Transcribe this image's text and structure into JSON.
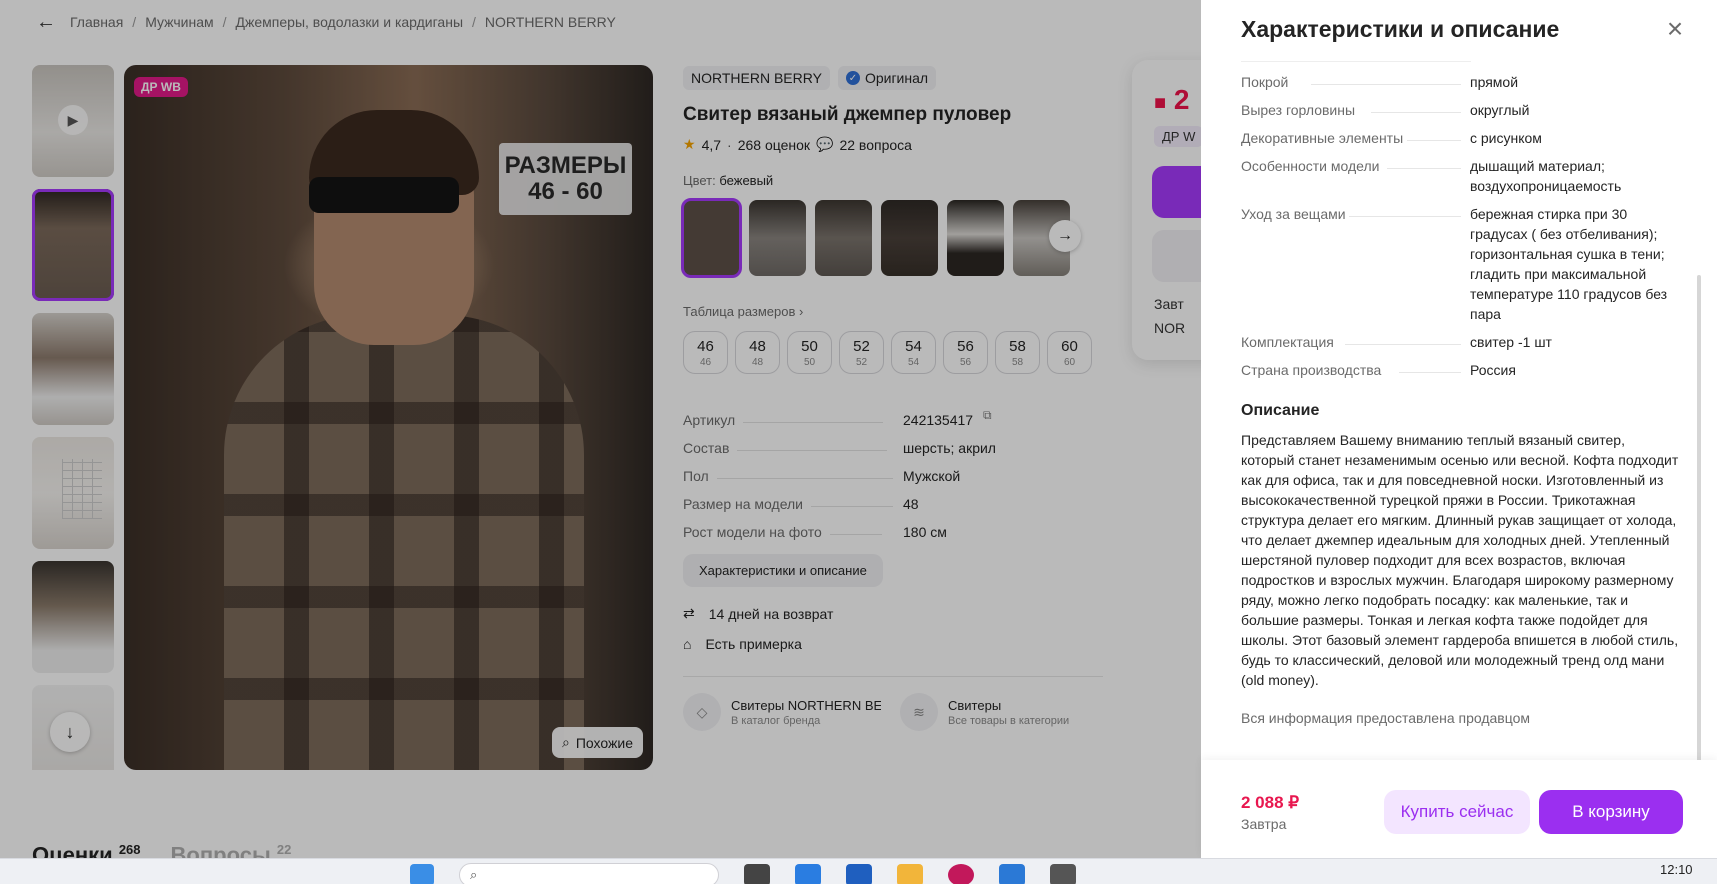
{
  "breadcrumbs": [
    "Главная",
    "Мужчинам",
    "Джемперы, водолазки и кардиганы",
    "NORTHERN BERRY"
  ],
  "gallery": {
    "badge": "ДР WB",
    "size_banner_line1": "РАЗМЕРЫ",
    "size_banner_line2": "46 - 60",
    "similar_label": "Похожие"
  },
  "product": {
    "brand": "NORTHERN BERRY",
    "original_label": "Оригинал",
    "title": "Свитер вязаный джемпер пуловер",
    "rating": "4,7",
    "reviews": "268 оценок",
    "questions": "22 вопроса",
    "color_label": "Цвет:",
    "color_value": "бежевый",
    "size_table_link": "Таблица размеров",
    "sizes": [
      {
        "ru": "46",
        "intl": "46"
      },
      {
        "ru": "48",
        "intl": "48"
      },
      {
        "ru": "50",
        "intl": "50"
      },
      {
        "ru": "52",
        "intl": "52"
      },
      {
        "ru": "54",
        "intl": "54"
      },
      {
        "ru": "56",
        "intl": "56"
      },
      {
        "ru": "58",
        "intl": "58"
      },
      {
        "ru": "60",
        "intl": "60"
      }
    ],
    "params": [
      {
        "k": "Артикул",
        "v": "242135417"
      },
      {
        "k": "Состав",
        "v": "шерсть; акрил"
      },
      {
        "k": "Пол",
        "v": "Мужской"
      },
      {
        "k": "Размер на модели",
        "v": "48"
      },
      {
        "k": "Рост модели на фото",
        "v": "180 см"
      }
    ],
    "char_button": "Характеристики и описание",
    "return_label": "14 дней на возврат",
    "fitting_label": "Есть примерка",
    "brand_cat_title": "Свитеры NORTHERN BERRY",
    "brand_cat_sub": "В каталог бренда",
    "cat_title": "Свитеры",
    "cat_sub": "Все товары в категории"
  },
  "price_card": {
    "price_fragment": "2",
    "dr_fragment": "ДР W",
    "delivery_fragment": "Завт",
    "seller_fragment": "NOR"
  },
  "bottom_tabs": {
    "reviews": "Оценки",
    "reviews_count": "268",
    "questions": "Вопросы",
    "questions_count": "22"
  },
  "panel": {
    "title": "Характеристики и описание",
    "specs": [
      {
        "k": "Покрой",
        "v": "прямой"
      },
      {
        "k": "Вырез горловины",
        "v": "округлый"
      },
      {
        "k": "Декоративные элементы",
        "v": "с рисунком"
      },
      {
        "k": "Особенности модели",
        "v": "дышащий материал; воздухопроницаемость"
      },
      {
        "k": "Уход за вещами",
        "v": "бережная стирка при 30 градусах ( без отбеливания); горизонтальная сушка в тени; гладить при максимальной температуре 110 градусов без пара"
      },
      {
        "k": "Комплектация",
        "v": "свитер -1 шт"
      },
      {
        "k": "Страна производства",
        "v": "Россия"
      }
    ],
    "desc_heading": "Описание",
    "description": "Представляем Вашему вниманию теплый вязаный свитер, который станет незаменимым осенью или весной. Кофта подходит как для офиса, так и для повседневной носки. Изготовленный из высококачественной турецкой пряжи в России. Трикотажная структура делает его мягким. Длинный рукав защищает от холода, что делает джемпер идеальным для холодных дней. Утепленный шерстяной пуловер подходит для всех возрастов, включая подростков и взрослых мужчин. Благодаря широкому размерному ряду, можно легко подобрать посадку: как маленькие, так и большие размеры. Тонкая и легкая кофта также подойдет для школы. Этот базовый элемент гардероба впишется в любой стиль, будь то классический, деловой или молодежный тренд олд мани (old money).",
    "seller_note": "Вся информация предоставлена продавцом",
    "footer_price": "2 088 ₽",
    "footer_delivery": "Завтра",
    "buy_now": "Купить сейчас",
    "to_cart": "В корзину"
  },
  "taskbar": {
    "clock": "12:10"
  },
  "colors": {
    "accent": "#a73afd",
    "price_red": "#e8174f",
    "overlay": "rgba(0,0,0,0.27)"
  }
}
